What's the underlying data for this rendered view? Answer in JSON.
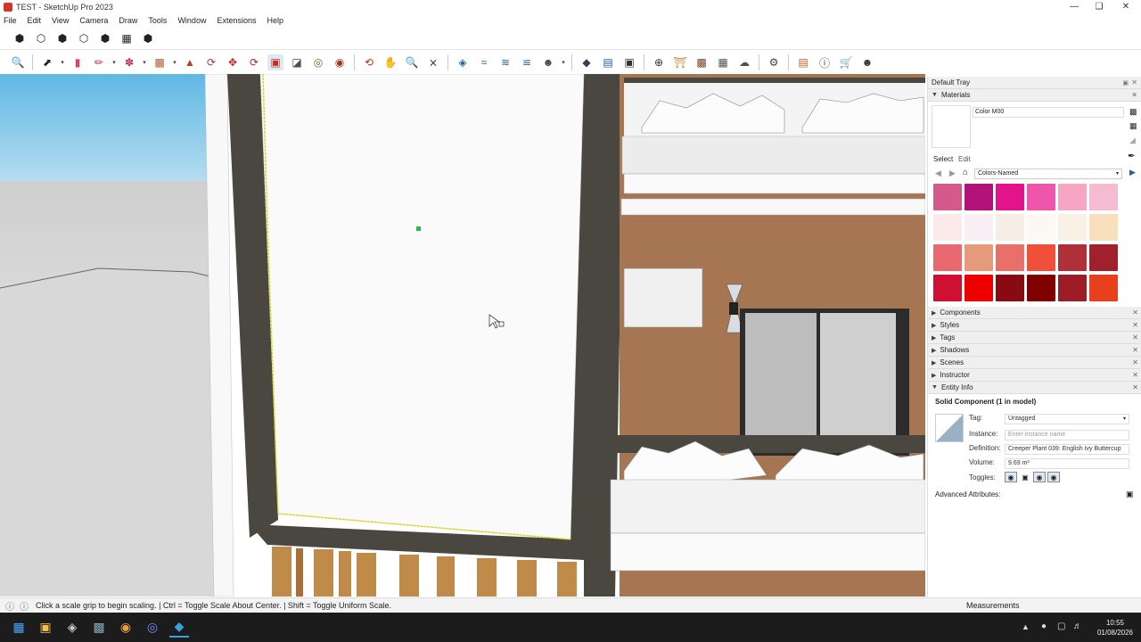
{
  "window": {
    "title": "TEST - SketchUp Pro 2023"
  },
  "menu": [
    "File",
    "Edit",
    "View",
    "Camera",
    "Draw",
    "Tools",
    "Window",
    "Extensions",
    "Help"
  ],
  "toolbar_views": [
    "iso-view-icon",
    "top-view-icon",
    "front-view-icon",
    "right-view-icon",
    "back-view-icon",
    "left-view-icon",
    "bottom-view-icon"
  ],
  "toolbar_main": [
    "search-icon",
    "select-icon",
    "eraser-icon",
    "pencil-icon",
    "freehand-shape-icon",
    "rectangle-icon",
    "push-pull-icon",
    "offset-icon",
    "move-icon",
    "rotate-icon",
    "scale-icon",
    "follow-me-icon",
    "tape-measure-icon",
    "paint-bucket-icon",
    "orbit-icon",
    "pan-icon",
    "zoom-icon",
    "zoom-extents-icon",
    "section-plane-icon",
    "section-display-icon",
    "section-fill-icon",
    "section-cut-icon",
    "profile-icon",
    "3d-warehouse-icon",
    "component-icon",
    "extension-icon",
    "add-location-icon",
    "sandbox-icon",
    "terrain-icon",
    "import-icon",
    "solid-tools-icon",
    "settings-icon",
    "layers-icon",
    "info-icon",
    "cart-icon",
    "account-icon"
  ],
  "tray": {
    "title": "Default Tray",
    "materials": {
      "header": "Materials",
      "name": "Color M00",
      "tab_select": "Select",
      "tab_edit": "Edit",
      "library": "Colors-Named",
      "swatches": [
        "#d45a8c",
        "#b0127a",
        "#e2148c",
        "#ee56ac",
        "#f6a6c2",
        "#f5bbd0",
        "#faeaea",
        "#f8eef3",
        "#f6eee6",
        "#fdf8f4",
        "#faf1e6",
        "#f8dfbe",
        "#e86a70",
        "#e59a7b",
        "#e87068",
        "#f0503a",
        "#b0303a",
        "#a0202c",
        "#d01030",
        "#ee0000",
        "#8a0a14",
        "#800000",
        "#9e1c28",
        "#e8401c"
      ]
    },
    "panels": [
      "Components",
      "Styles",
      "Tags",
      "Shadows",
      "Scenes",
      "Instructor",
      "Entity Info"
    ],
    "entity_info": {
      "title": "Solid Component (1 in model)",
      "tag_label": "Tag:",
      "tag_value": "Untagged",
      "instance_label": "Instance:",
      "instance_placeholder": "Enter instance name",
      "definition_label": "Definition:",
      "definition_value": "Creeper Plant 039: English Ivy Buttercup",
      "volume_label": "Volume:",
      "volume_value": "9.69 m³",
      "toggles_label": "Toggles:",
      "advanced": "Advanced Attributes:"
    }
  },
  "status": {
    "message": "Click a scale grip to begin scaling. | Ctrl = Toggle Scale About Center. | Shift = Toggle Uniform Scale.",
    "measurements_label": "Measurements"
  },
  "taskbar": {
    "time": "10:55",
    "date": "01/08/2026",
    "apps": [
      "windows-start-icon",
      "file-explorer-icon",
      "app-icon",
      "app-icon",
      "chrome-icon",
      "discord-icon",
      "sketchup-icon"
    ]
  }
}
